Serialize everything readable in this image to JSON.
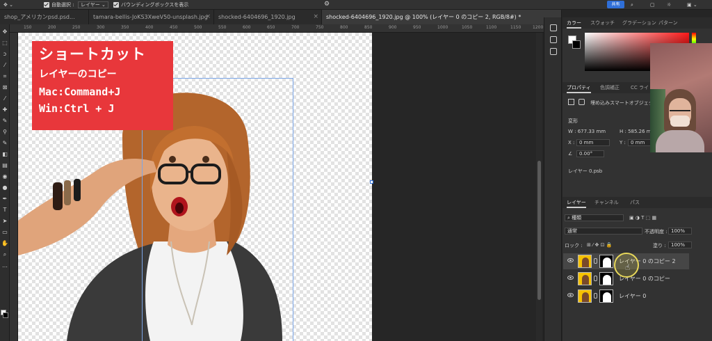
{
  "option_bar": {
    "auto_select_label": "自動選択 :",
    "auto_select_value": "レイヤー",
    "bounding_box_label": "バウンディングボックスを表示",
    "share_label": "共有"
  },
  "tabs": [
    {
      "label": "shop_アメリカンpsd.psd..."
    },
    {
      "label": "tamara-bellis-JoKS3XweV50-unsplash.jpg"
    },
    {
      "label": "shocked-6404696_1920.jpg"
    },
    {
      "label": "shocked-6404696_1920.jpg @ 100% (レイヤー 0 のコピー 2, RGB/8#) *"
    }
  ],
  "ruler": {
    "ticks": [
      "150",
      "200",
      "250",
      "300",
      "350",
      "400",
      "450",
      "500",
      "550",
      "600",
      "650",
      "700",
      "750",
      "800",
      "850",
      "900",
      "950",
      "1000",
      "1050",
      "1100",
      "1150",
      "1200"
    ]
  },
  "tutorial_card": {
    "line1": "ショートカット",
    "line2": "レイヤーのコピー",
    "line3": "Mac:Command+J",
    "line4": "Win:Ctrl + J",
    "background_color": "#e8373b"
  },
  "color_panel": {
    "tabs": [
      "カラー",
      "スウォッチ",
      "グラデーション",
      "パターン"
    ]
  },
  "properties_panel": {
    "tabs": [
      "プロパティ",
      "色調補正",
      "CC ライ"
    ],
    "object_type": "埋め込みスマートオブジェク",
    "transform_label": "変形",
    "w_label": "W : 677.33 mm",
    "h_label": "H : 585.26 m",
    "x_label": "X :",
    "x_value": "0 mm",
    "y_label": "Y :",
    "y_value": "0 mm",
    "angle_value": "0.00°",
    "file_name": "レイヤー 0.psb"
  },
  "layers_panel": {
    "tabs": [
      "レイヤー",
      "チャンネル",
      "パス"
    ],
    "filter_label": "種類",
    "blend_mode": "通常",
    "opacity_label": "不透明度 :",
    "opacity_value": "100%",
    "lock_label": "ロック :",
    "fill_label": "塗り :",
    "fill_value": "100%",
    "layers": [
      {
        "name": "レイヤー 0 のコピー 2",
        "selected": true
      },
      {
        "name": "レイヤー 0 のコピー",
        "selected": false
      },
      {
        "name": "レイヤー 0",
        "selected": false
      }
    ]
  },
  "icons": [
    "move-icon",
    "home-icon",
    "search-icon",
    "gear-icon",
    "eye-icon",
    "link-icon",
    "lock-icon"
  ]
}
